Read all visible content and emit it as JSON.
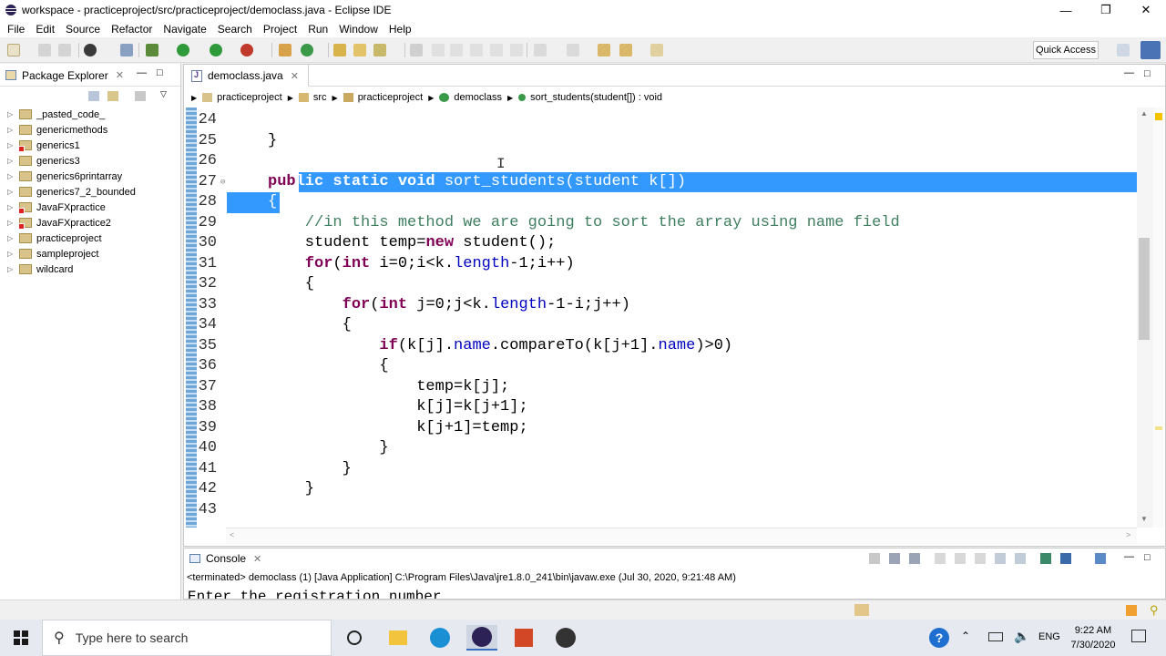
{
  "window": {
    "title": "workspace - practiceproject/src/practiceproject/democlass.java - Eclipse IDE",
    "controls": [
      "minimize-icon",
      "restore-icon",
      "close-icon"
    ]
  },
  "menu": [
    "File",
    "Edit",
    "Source",
    "Refactor",
    "Navigate",
    "Search",
    "Project",
    "Run",
    "Window",
    "Help"
  ],
  "toolbar": {
    "quick_access": "Quick Access"
  },
  "package_explorer": {
    "title": "Package Explorer",
    "projects": [
      {
        "name": "_pasted_code_",
        "error": false
      },
      {
        "name": "genericmethods",
        "error": false
      },
      {
        "name": "generics1",
        "error": true
      },
      {
        "name": "generics3",
        "error": false
      },
      {
        "name": "generics6printarray",
        "error": false
      },
      {
        "name": "generics7_2_bounded",
        "error": false
      },
      {
        "name": "JavaFXpractice",
        "error": true
      },
      {
        "name": "JavaFXpractice2",
        "error": true
      },
      {
        "name": "practiceproject",
        "error": false
      },
      {
        "name": "sampleproject",
        "error": false
      },
      {
        "name": "wildcard",
        "error": false
      }
    ]
  },
  "editor": {
    "tab": "democlass.java",
    "breadcrumb": [
      "practiceproject",
      "src",
      "practiceproject",
      "democlass",
      "sort_students(student[]) : void"
    ],
    "code_lines": [
      {
        "n": "24",
        "text": ""
      },
      {
        "n": "25",
        "text": "}"
      },
      {
        "n": "26",
        "text": ""
      },
      {
        "n": "27",
        "text": "public static void sort_students(student k[])"
      },
      {
        "n": "28",
        "text": "{"
      },
      {
        "n": "29",
        "text": "    //in this method we are going to sort the array using name field"
      },
      {
        "n": "30",
        "text": "    student temp=new student();"
      },
      {
        "n": "31",
        "text": "    for(int i=0;i<k.length-1;i++)"
      },
      {
        "n": "32",
        "text": "    {"
      },
      {
        "n": "33",
        "text": "        for(int j=0;j<k.length-1-i;j++)"
      },
      {
        "n": "34",
        "text": "        {"
      },
      {
        "n": "35",
        "text": "            if(k[j].name.compareTo(k[j+1].name)>0)"
      },
      {
        "n": "36",
        "text": "            {"
      },
      {
        "n": "37",
        "text": "                temp=k[j];"
      },
      {
        "n": "38",
        "text": "                k[j]=k[j+1];"
      },
      {
        "n": "39",
        "text": "                k[j+1]=temp;"
      },
      {
        "n": "40",
        "text": "            }"
      },
      {
        "n": "41",
        "text": "        }"
      },
      {
        "n": "42",
        "text": "    }"
      },
      {
        "n": "43",
        "text": ""
      }
    ]
  },
  "console": {
    "title": "Console",
    "terminated": "<terminated> democlass (1) [Java Application] C:\\Program Files\\Java\\jre1.8.0_241\\bin\\javaw.exe (Jul 30, 2020, 9:21:48 AM)",
    "output": "Enter the registration number"
  },
  "taskbar": {
    "search_placeholder": "Type here to search",
    "language": "ENG",
    "time": "9:22 AM",
    "date": "7/30/2020"
  }
}
